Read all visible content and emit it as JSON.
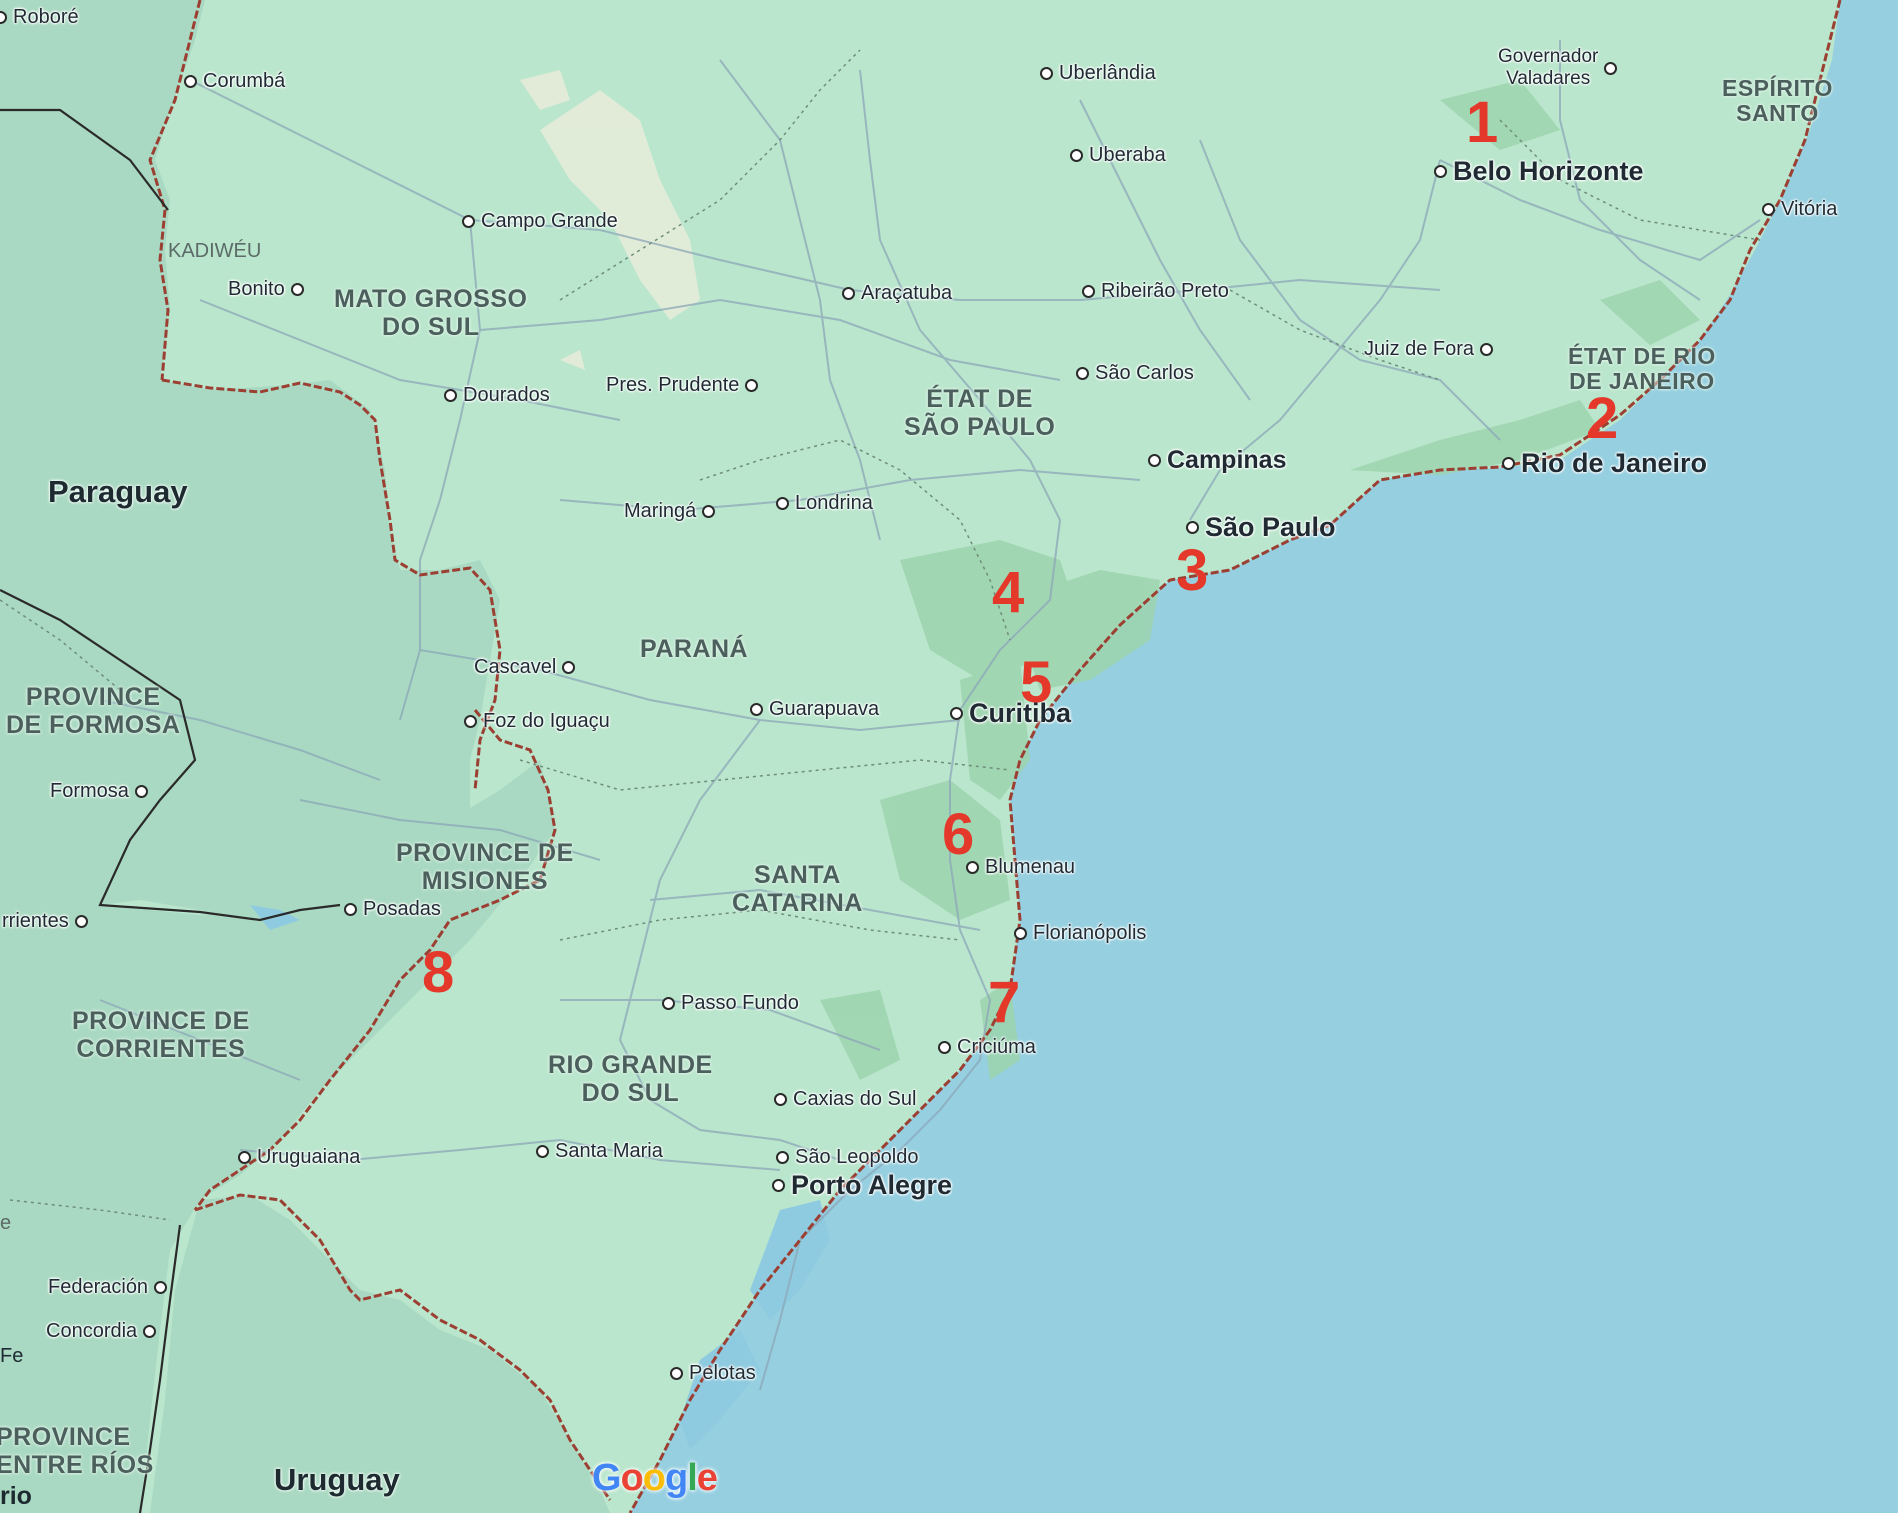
{
  "cities": [
    {
      "name": "Roboré",
      "size": "small"
    },
    {
      "name": "Corumbá",
      "size": "small"
    },
    {
      "name": "Uberlândia",
      "size": "small"
    },
    {
      "name": "Governador\nValadares",
      "size": "small"
    },
    {
      "name": "Uberaba",
      "size": "small"
    },
    {
      "name": "Belo Horizonte",
      "size": "big"
    },
    {
      "name": "Vitória",
      "size": "small"
    },
    {
      "name": "Campo Grande",
      "size": "small"
    },
    {
      "name": "Bonito",
      "size": "small"
    },
    {
      "name": "Araçatuba",
      "size": "small"
    },
    {
      "name": "Ribeirão Preto",
      "size": "small"
    },
    {
      "name": "Juiz de Fora",
      "size": "small"
    },
    {
      "name": "Dourados",
      "size": "small"
    },
    {
      "name": "Pres. Prudente",
      "size": "small"
    },
    {
      "name": "São Carlos",
      "size": "small"
    },
    {
      "name": "Campinas",
      "size": "big"
    },
    {
      "name": "Rio de Janeiro",
      "size": "big"
    },
    {
      "name": "Maringá",
      "size": "small"
    },
    {
      "name": "Londrina",
      "size": "small"
    },
    {
      "name": "São Paulo",
      "size": "big"
    },
    {
      "name": "Cascavel",
      "size": "small"
    },
    {
      "name": "Guarapuava",
      "size": "small"
    },
    {
      "name": "Curitiba",
      "size": "big"
    },
    {
      "name": "Foz do Iguaçu",
      "size": "small"
    },
    {
      "name": "Formosa",
      "size": "small"
    },
    {
      "name": "Blumenau",
      "size": "small"
    },
    {
      "name": "Posadas",
      "size": "small"
    },
    {
      "name": "rrientes",
      "size": "small"
    },
    {
      "name": "Florianópolis",
      "size": "small"
    },
    {
      "name": "Passo Fundo",
      "size": "small"
    },
    {
      "name": "Criciúma",
      "size": "small"
    },
    {
      "name": "Caxias do Sul",
      "size": "small"
    },
    {
      "name": "Santa Maria",
      "size": "small"
    },
    {
      "name": "Uruguaiana",
      "size": "small"
    },
    {
      "name": "São Leopoldo",
      "size": "small"
    },
    {
      "name": "Porto Alegre",
      "size": "big"
    },
    {
      "name": "Federación",
      "size": "small"
    },
    {
      "name": "Concordia",
      "size": "small"
    },
    {
      "name": "Pelotas",
      "size": "small"
    }
  ],
  "regions": [
    "ESPÍRITO\nSANTO",
    "MATO GROSSO\nDO SUL",
    "ÉTAT DE\nSÃO PAULO",
    "ÉTAT DE RIO\nDE JANEIRO",
    "PARANÁ",
    "PROVINCE\nDE FORMOSA",
    "PROVINCE DE\nMISIONES",
    "SANTA\nCATARINA",
    "PROVINCE DE\nCORRIENTES",
    "RIO GRANDE\nDO SUL",
    "PROVINCE\nENTRE RÍOS"
  ],
  "countries": [
    "Paraguay",
    "Uruguay"
  ],
  "minor_labels": [
    "KADIWÉU",
    "rio",
    "e",
    "Fe"
  ],
  "markers": [
    "1",
    "2",
    "3",
    "4",
    "5",
    "6",
    "7",
    "8"
  ],
  "logo": {
    "letters": [
      "G",
      "o",
      "o",
      "g",
      "l",
      "e"
    ],
    "colors": [
      "#4285f4",
      "#ea4335",
      "#fbbc05",
      "#4285f4",
      "#34a853",
      "#ea4335"
    ]
  },
  "colors": {
    "land": "#b9e6cc",
    "ocean": "#95cfe0",
    "neighbor_land": "#a7d8c0",
    "road": "#8ca7b8",
    "border": "#a04a3d",
    "protected_area": "#9fd6b0",
    "marker": "#e4382b"
  }
}
